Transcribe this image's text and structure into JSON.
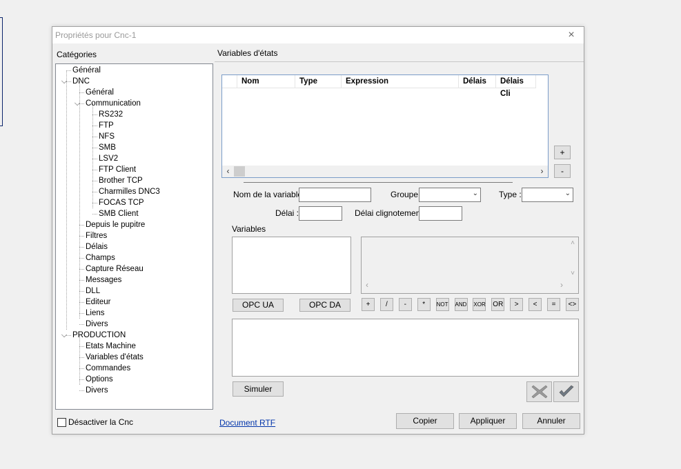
{
  "window": {
    "title": "Propriétés pour Cnc-1",
    "close_icon": "×"
  },
  "left": {
    "header": "Catégories",
    "tree": [
      {
        "label": "Général",
        "level": 0
      },
      {
        "label": "DNC",
        "level": 0,
        "expanded": true
      },
      {
        "label": "Général",
        "level": 1
      },
      {
        "label": "Communication",
        "level": 1,
        "expanded": true
      },
      {
        "label": "RS232",
        "level": 2
      },
      {
        "label": "FTP",
        "level": 2
      },
      {
        "label": "NFS",
        "level": 2
      },
      {
        "label": "SMB",
        "level": 2
      },
      {
        "label": "LSV2",
        "level": 2
      },
      {
        "label": "FTP Client",
        "level": 2
      },
      {
        "label": "Brother TCP",
        "level": 2
      },
      {
        "label": "Charmilles DNC3",
        "level": 2
      },
      {
        "label": "FOCAS TCP",
        "level": 2
      },
      {
        "label": "SMB Client",
        "level": 2
      },
      {
        "label": "Depuis le pupitre",
        "level": 1
      },
      {
        "label": "Filtres",
        "level": 1
      },
      {
        "label": "Délais",
        "level": 1
      },
      {
        "label": "Champs",
        "level": 1
      },
      {
        "label": "Capture Réseau",
        "level": 1
      },
      {
        "label": "Messages",
        "level": 1
      },
      {
        "label": "DLL",
        "level": 1
      },
      {
        "label": "Editeur",
        "level": 1
      },
      {
        "label": "Liens",
        "level": 1
      },
      {
        "label": "Divers",
        "level": 1
      },
      {
        "label": "PRODUCTION",
        "level": 0,
        "expanded": true
      },
      {
        "label": "Etats Machine",
        "level": 1
      },
      {
        "label": "Variables d'états",
        "level": 1
      },
      {
        "label": "Commandes",
        "level": 1
      },
      {
        "label": "Options",
        "level": 1
      },
      {
        "label": "Divers",
        "level": 1
      }
    ],
    "disable_label": "Désactiver la Cnc"
  },
  "right": {
    "header": "Variables d'états",
    "columns": [
      "Nom",
      "Type",
      "Expression",
      "Délais",
      "Délais Cli"
    ],
    "add_label": "+",
    "remove_label": "-",
    "var_name_label": "Nom de la variable :",
    "group_label": "Groupe :",
    "type_label": "Type :",
    "delay_label": "Délai :",
    "blink_delay_label": "Délai clignotement :",
    "variables_label": "Variables",
    "opc_ua": "OPC UA",
    "opc_da": "OPC DA",
    "operators": [
      "+",
      "/",
      "-",
      "*",
      "NOT",
      "AND",
      "XOR",
      "OR",
      ">",
      "<",
      "=",
      "<>"
    ],
    "simulate": "Simuler"
  },
  "footer": {
    "rtf_link": "Document RTF",
    "copy": "Copier",
    "apply": "Appliquer",
    "cancel": "Annuler"
  }
}
